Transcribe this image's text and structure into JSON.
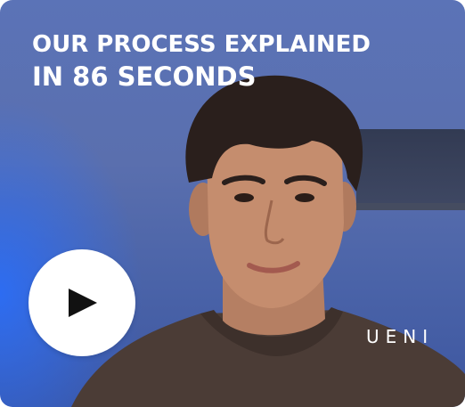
{
  "video_card": {
    "title_line1": "OUR PROCESS EXPLAINED",
    "title_line2": "IN 86 SECONDS",
    "brand_logo": "UENI",
    "play_icon": "play-icon",
    "colors": {
      "background_blue": "#5a6fae",
      "accent_blue": "#2b6dff",
      "text": "#ffffff",
      "play_button": "#ffffff",
      "play_glyph": "#111111"
    }
  }
}
